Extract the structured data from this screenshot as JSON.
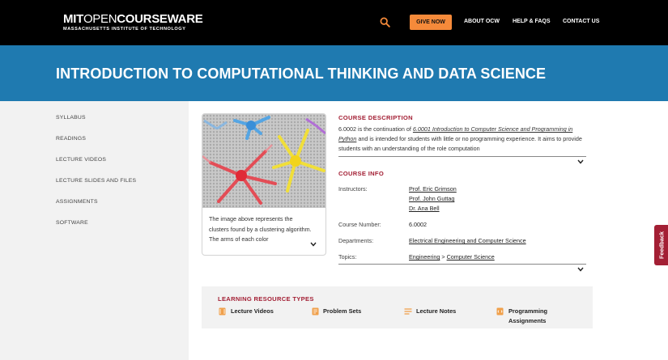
{
  "header": {
    "logo_main_mit": "MIT",
    "logo_main_open": "OPEN",
    "logo_main_cw": "COURSEWARE",
    "logo_sub": "MASSACHUSETTS INSTITUTE OF TECHNOLOGY",
    "search_icon": "search-icon",
    "give_now": "GIVE NOW",
    "nav": [
      "ABOUT OCW",
      "HELP & FAQS",
      "CONTACT US"
    ]
  },
  "banner": {
    "title": "INTRODUCTION TO COMPUTATIONAL THINKING AND DATA SCIENCE"
  },
  "sidebar": {
    "items": [
      "SYLLABUS",
      "READINGS",
      "LECTURE VIDEOS",
      "LECTURE SLIDES AND FILES",
      "ASSIGNMENTS",
      "SOFTWARE"
    ]
  },
  "image_card": {
    "caption": "The image above represents the clusters found by a clustering algorithm. The arms of each color"
  },
  "course_description": {
    "heading": "COURSE DESCRIPTION",
    "text_before": "6.0002 is the continuation of ",
    "link_text": "6.0001 Introduction to Computer Science and Programming in Python",
    "text_after": " and is intended for students with little or no programming experience. It aims to provide students with an understanding of the role computation"
  },
  "course_info": {
    "heading": "COURSE INFO",
    "instructors_label": "Instructors:",
    "instructors": [
      "Prof. Eric Grimson",
      "Prof. John Guttag",
      "Dr. Ana Bell"
    ],
    "course_number_label": "Course Number:",
    "course_number": "6.0002",
    "departments_label": "Departments:",
    "department": "Electrical Engineering and Computer Science",
    "topics_label": "Topics:",
    "topic_1": "Engineering",
    "topic_sep": ">",
    "topic_2": "Computer Science"
  },
  "learning_resources": {
    "heading": "LEARNING RESOURCE TYPES",
    "items": [
      {
        "label": "Lecture Videos",
        "icon": "video-icon"
      },
      {
        "label": "Problem Sets",
        "icon": "problem-set-icon"
      },
      {
        "label": "Lecture Notes",
        "icon": "notes-icon"
      },
      {
        "label_line1": "Programming",
        "label_line2": "Assignments",
        "icon": "programming-icon"
      }
    ]
  },
  "feedback": {
    "label": "Feedback"
  },
  "colors": {
    "accent": "#a31f34",
    "banner": "#1f7ab0",
    "give_now": "#f58a3a",
    "icon_orange": "#f0a04b"
  }
}
